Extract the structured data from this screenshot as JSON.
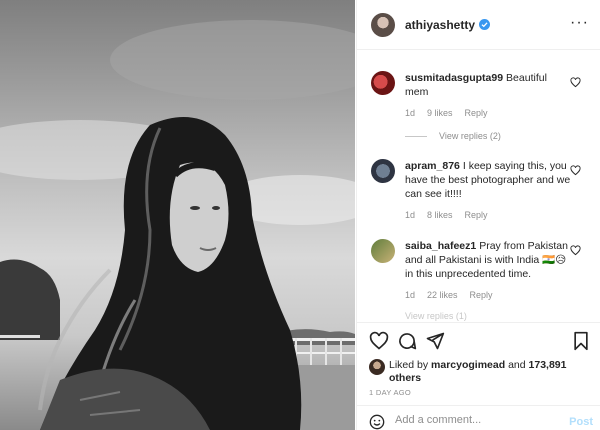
{
  "post": {
    "image_alt": "Black and white photo of a woman with long dark hair",
    "owner": {
      "username": "athiyashetty",
      "verified": true,
      "avatar_icon": "profile-avatar"
    },
    "more_icon": "more-options-icon",
    "more_glyph": "···"
  },
  "comments": [
    {
      "username": "susmitadasgupta99",
      "text": "Beautiful mem",
      "age": "1d",
      "likes": "9 likes",
      "reply": "Reply",
      "view_replies": "View replies (2)"
    },
    {
      "username": "apram_876",
      "text": "I keep saying this, you have the best photographer and we can see it!!!!",
      "age": "1d",
      "likes": "8 likes",
      "reply": "Reply"
    },
    {
      "username": "saiba_hafeez1",
      "text": "Pray from Pakistan and all Pakistani is with India 🇮🇳😥 in this unprecedented time.",
      "age": "1d",
      "likes": "22 likes",
      "reply": "Reply",
      "view_replies": "View replies (1)"
    }
  ],
  "actions": {
    "like_icon": "heart-icon",
    "comment_icon": "comment-icon",
    "share_icon": "share-icon",
    "save_icon": "bookmark-icon"
  },
  "likes_summary": {
    "prefix": "Liked by",
    "user": "marcyogimead",
    "conjunction": "and",
    "count": "173,891 others"
  },
  "timestamp": "1 day ago",
  "add_comment": {
    "placeholder": "Add a comment...",
    "post_label": "Post"
  },
  "colors": {
    "verified_blue": "#3897f0",
    "text": "#262626",
    "muted": "#8e8e8e",
    "post_disabled": "#b2dffc"
  }
}
